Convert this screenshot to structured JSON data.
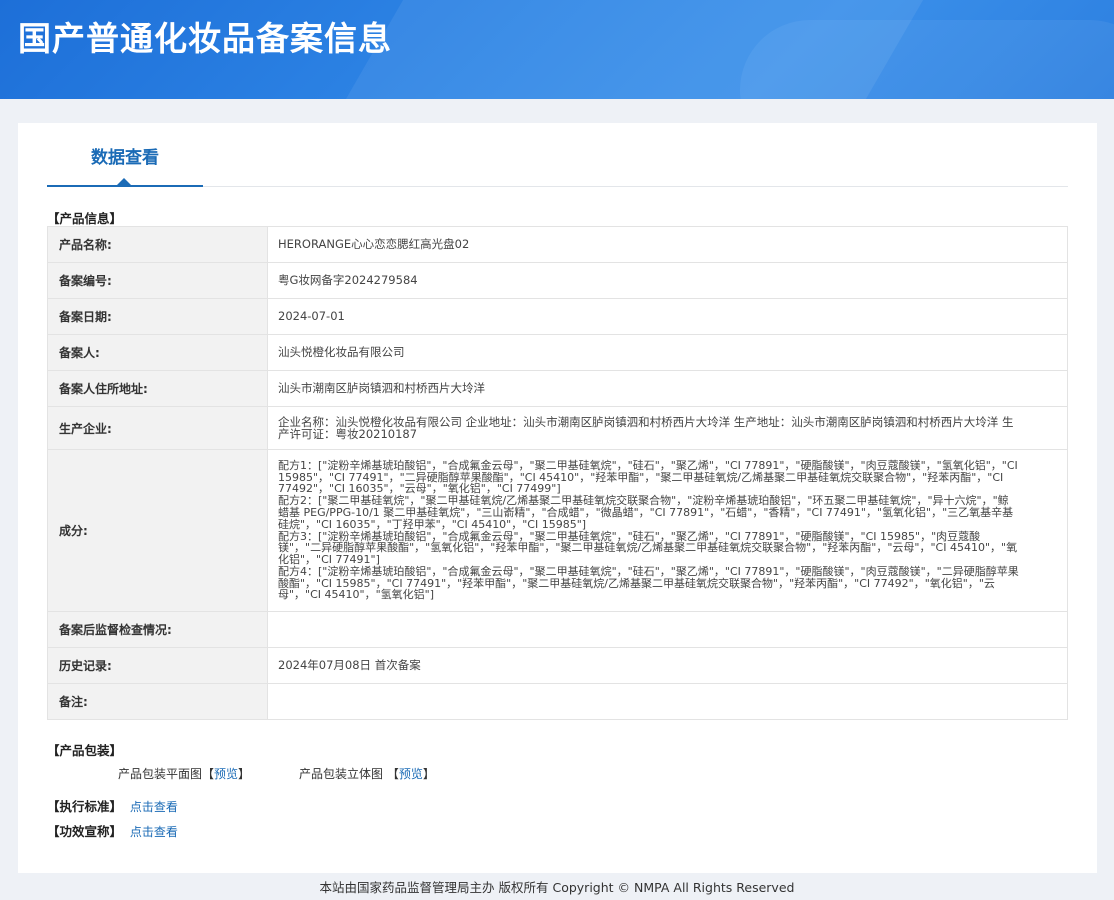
{
  "header": {
    "title": "国产普通化妆品备案信息"
  },
  "tabs": [
    {
      "label": "数据查看"
    }
  ],
  "product_info": {
    "section_label": "【产品信息】",
    "rows": [
      {
        "key": "产品名称:",
        "value": "HERORANGE心心恋恋腮红高光盘02"
      },
      {
        "key": "备案编号:",
        "value": "粤G妆网备字2024279584"
      },
      {
        "key": "备案日期:",
        "value": "2024-07-01"
      },
      {
        "key": "备案人:",
        "value": "汕头悦橙化妆品有限公司"
      },
      {
        "key": "备案人住所地址:",
        "value": "汕头市潮南区胪岗镇泗和村桥西片大坽洋"
      },
      {
        "key": "生产企业:",
        "value": "企业名称：汕头悦橙化妆品有限公司 企业地址：汕头市潮南区胪岗镇泗和村桥西片大坽洋 生产地址：汕头市潮南区胪岗镇泗和村桥西片大坽洋 生产许可证：粤妆20210187"
      },
      {
        "key": "成分:",
        "value": "配方1：[\"淀粉辛烯基琥珀酸铝\"，\"合成氟金云母\"，\"聚二甲基硅氧烷\"，\"硅石\"，\"聚乙烯\"，\"CI 77891\"，\"硬脂酸镁\"，\"肉豆蔻酸镁\"，\"氢氧化铝\"，\"CI 15985\"，\"CI 77491\"，\"二异硬脂醇苹果酸酯\"，\"CI 45410\"，\"羟苯甲酯\"，\"聚二甲基硅氧烷/乙烯基聚二甲基硅氧烷交联聚合物\"，\"羟苯丙酯\"，\"CI 77492\"，\"CI 16035\"，\"云母\"，\"氧化铝\"，\"CI 77499\"]\n配方2：[\"聚二甲基硅氧烷\"，\"聚二甲基硅氧烷/乙烯基聚二甲基硅氧烷交联聚合物\"，\"淀粉辛烯基琥珀酸铝\"，\"环五聚二甲基硅氧烷\"，\"异十六烷\"，\"鲸蜡基 PEG/PPG-10/1 聚二甲基硅氧烷\"，\"三山嵛精\"，\"合成蜡\"，\"微晶蜡\"，\"CI 77891\"，\"石蜡\"，\"香精\"，\"CI 77491\"，\"氢氧化铝\"，\"三乙氧基辛基硅烷\"，\"CI 16035\"，\"丁羟甲苯\"，\"CI 45410\"，\"CI 15985\"]\n配方3：[\"淀粉辛烯基琥珀酸铝\"，\"合成氟金云母\"，\"聚二甲基硅氧烷\"，\"硅石\"，\"聚乙烯\"，\"CI 77891\"，\"硬脂酸镁\"，\"CI 15985\"，\"肉豆蔻酸镁\"，\"二异硬脂醇苹果酸酯\"，\"氢氧化铝\"，\"羟苯甲酯\"，\"聚二甲基硅氧烷/乙烯基聚二甲基硅氧烷交联聚合物\"，\"羟苯丙酯\"，\"云母\"，\"CI 45410\"，\"氧化铝\"，\"CI 77491\"]\n配方4：[\"淀粉辛烯基琥珀酸铝\"，\"合成氟金云母\"，\"聚二甲基硅氧烷\"，\"硅石\"，\"聚乙烯\"，\"CI 77891\"，\"硬脂酸镁\"，\"肉豆蔻酸镁\"，\"二异硬脂醇苹果酸酯\"，\"CI 15985\"，\"CI 77491\"，\"羟苯甲酯\"，\"聚二甲基硅氧烷/乙烯基聚二甲基硅氧烷交联聚合物\"，\"羟苯丙酯\"，\"CI 77492\"，\"氧化铝\"，\"云母\"，\"CI 45410\"，\"氢氧化铝\"]"
      },
      {
        "key": "备案后监督检查情况:",
        "value": ""
      },
      {
        "key": "历史记录:",
        "value": "2024年07月08日 首次备案"
      },
      {
        "key": "备注:",
        "value": ""
      }
    ]
  },
  "packaging": {
    "section_label": "【产品包装】",
    "flat_label": "产品包装平面图",
    "flat_bracket_open": "【",
    "flat_link": "预览",
    "flat_bracket_close": "】",
    "solid_label": "产品包装立体图",
    "solid_bracket_open": "【",
    "solid_link": "预览",
    "solid_bracket_close": "】"
  },
  "standard": {
    "label": "【执行标准】",
    "link": "点击查看"
  },
  "efficacy": {
    "label": "【功效宣称】",
    "link": "点击查看"
  },
  "footer": {
    "text": "本站由国家药品监督管理局主办 版权所有 Copyright © NMPA All Rights Reserved"
  }
}
